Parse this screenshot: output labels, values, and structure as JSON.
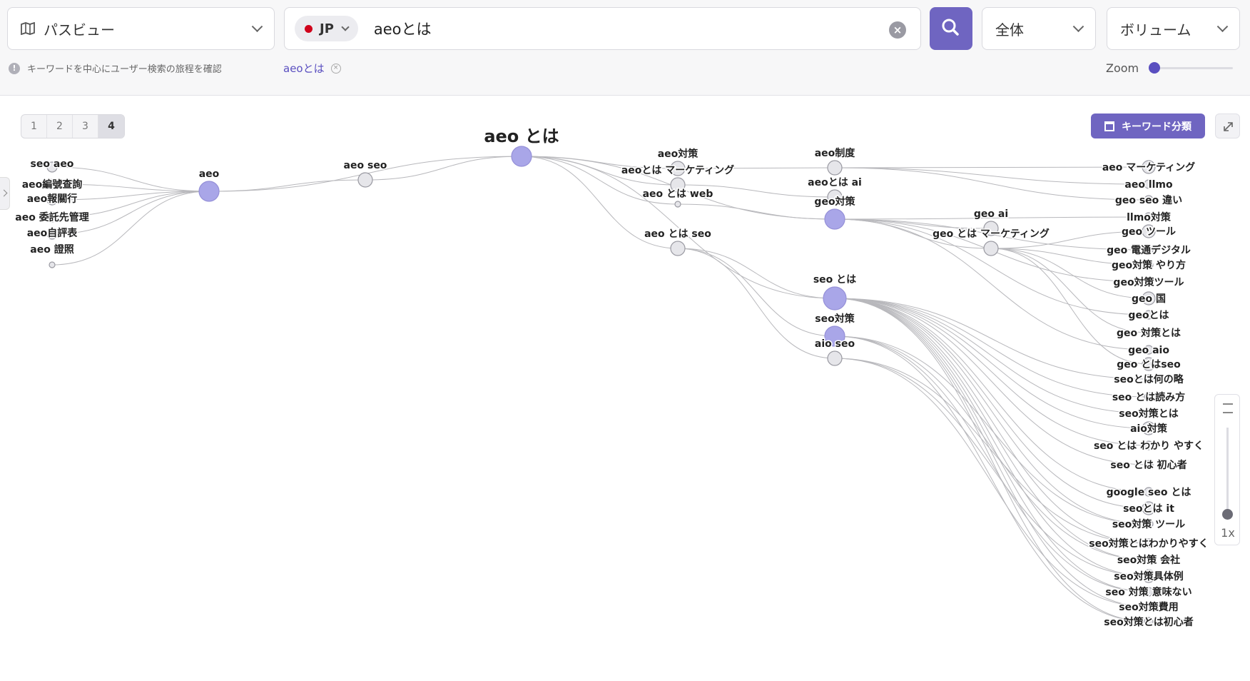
{
  "header": {
    "view_select": {
      "label": "パスビュー",
      "icon": "map-icon"
    },
    "search": {
      "country": "JP",
      "query": "aeoとは"
    },
    "scope_select": {
      "label": "全体"
    },
    "sort_select": {
      "label": "ボリューム"
    },
    "hint": "キーワードを中心にユーザー検索の旅程を確認",
    "chip": "aeoとは",
    "zoom_label": "Zoom"
  },
  "toolbar": {
    "levels": [
      "1",
      "2",
      "3",
      "4"
    ],
    "active_level": "4",
    "keyword_button": "キーワード分類",
    "vertical_zoom": "1x"
  },
  "colors": {
    "accent": "#6f65c1",
    "node_big": "#a9a6e8",
    "node_small": "#e6e6ea",
    "edge": "#b8b8bc"
  },
  "graph": {
    "root": "aeo とは",
    "columns": [
      {
        "nodes": [
          {
            "id": "aeo-seoaeo",
            "label": "seo aeo",
            "size": "s"
          },
          {
            "id": "aeo-1",
            "label": "aeo編號查詢",
            "size": "s"
          },
          {
            "id": "aeo-2",
            "label": "aeo報關行",
            "size": "s"
          },
          {
            "id": "aeo-3",
            "label": "aeo 委託先管理",
            "size": "s"
          },
          {
            "id": "aeo-4",
            "label": "aeo自評表",
            "size": "s"
          },
          {
            "id": "aeo-5",
            "label": "aeo 證照",
            "size": "xs"
          }
        ]
      },
      {
        "nodes": [
          {
            "id": "aeo",
            "label": "aeo",
            "size": "l"
          }
        ]
      },
      {
        "nodes": [
          {
            "id": "aeoseo",
            "label": "aeo seo",
            "size": "m"
          }
        ]
      },
      {
        "nodes": [
          {
            "id": "root",
            "label": "aeo とは",
            "size": "l"
          }
        ]
      },
      {
        "nodes": [
          {
            "id": "aeotaisaku",
            "label": "aeo対策",
            "size": "m"
          },
          {
            "id": "aeomkt",
            "label": "aeoとは マーケティング",
            "size": "m"
          },
          {
            "id": "aeoweb",
            "label": "aeo とは web",
            "size": "xs"
          },
          {
            "id": "aeotoseo",
            "label": "aeo とは seo",
            "size": "m"
          }
        ]
      },
      {
        "nodes": [
          {
            "id": "aeoseido",
            "label": "aeo制度",
            "size": "m"
          },
          {
            "id": "aeoai",
            "label": "aeoとは ai",
            "size": "m"
          },
          {
            "id": "geotaisaku",
            "label": "geo対策",
            "size": "l"
          },
          {
            "id": "seotoha",
            "label": "seo とは",
            "size": "xl"
          },
          {
            "id": "seotaisaku",
            "label": "seo対策",
            "size": "l"
          },
          {
            "id": "aioseo",
            "label": "aio seo",
            "size": "m"
          }
        ]
      },
      {
        "nodes": [
          {
            "id": "geoai",
            "label": "geo ai",
            "size": "m"
          },
          {
            "id": "geomkt",
            "label": "geo とは マーケティング",
            "size": "m"
          }
        ]
      },
      {
        "nodes": [
          {
            "label": "aeo マーケティング"
          },
          {
            "label": "aeo llmo"
          },
          {
            "label": "geo seo 違い"
          },
          {
            "label": "llmo対策"
          },
          {
            "label": "geo ツール"
          },
          {
            "label": "geo 電通デジタル"
          },
          {
            "label": "geo対策 やり方"
          },
          {
            "label": "geo対策ツール"
          },
          {
            "label": "geo 国"
          },
          {
            "label": "geoとは"
          },
          {
            "label": "geo 対策とは"
          },
          {
            "label": "geo aio"
          },
          {
            "label": "geo とはseo"
          },
          {
            "label": "seoとは何の略"
          },
          {
            "label": "seo とは読み方"
          },
          {
            "label": "seo対策とは"
          },
          {
            "label": "aio対策"
          },
          {
            "label": "seo とは わかり やすく"
          },
          {
            "label": "seo とは 初心者"
          },
          {
            "label": "google seo とは"
          },
          {
            "label": "seoとは it"
          },
          {
            "label": "seo対策 ツール"
          },
          {
            "label": "seo対策とはわかりやすく"
          },
          {
            "label": "seo対策 会社"
          },
          {
            "label": "seo対策具体例"
          },
          {
            "label": "seo 対策 意味ない"
          },
          {
            "label": "seo対策費用"
          },
          {
            "label": "seo対策とは初心者"
          }
        ]
      }
    ]
  }
}
